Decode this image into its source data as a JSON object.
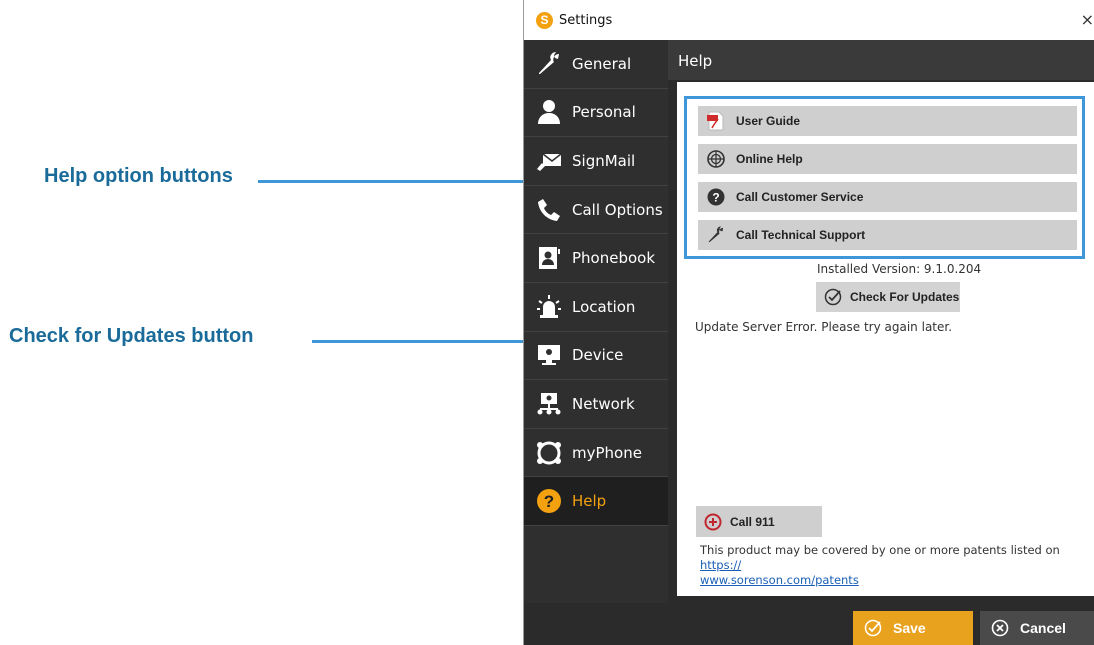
{
  "callouts": {
    "help_options": "Help option buttons",
    "check_updates": "Check for Updates button"
  },
  "window": {
    "title": "Settings",
    "logo_glyph": "S",
    "close_glyph": "×"
  },
  "sidebar": {
    "items": [
      {
        "label": "General",
        "icon": "wrench-icon"
      },
      {
        "label": "Personal",
        "icon": "person-icon"
      },
      {
        "label": "SignMail",
        "icon": "signmail-icon"
      },
      {
        "label": "Call Options",
        "icon": "phone-handset-icon"
      },
      {
        "label": "Phonebook",
        "icon": "phonebook-icon"
      },
      {
        "label": "Location",
        "icon": "siren-icon"
      },
      {
        "label": "Device",
        "icon": "monitor-icon"
      },
      {
        "label": "Network",
        "icon": "network-icon"
      },
      {
        "label": "myPhone",
        "icon": "myphone-icon"
      },
      {
        "label": "Help",
        "icon": "question-icon",
        "active": true
      }
    ]
  },
  "main": {
    "title": "Help",
    "help_buttons": [
      {
        "label": "User Guide",
        "icon": "pdf-icon"
      },
      {
        "label": "Online Help",
        "icon": "globe-icon"
      },
      {
        "label": "Call Customer Service",
        "icon": "question-circle-icon"
      },
      {
        "label": "Call Technical Support",
        "icon": "wrench-icon"
      }
    ],
    "installed_version": "Installed Version:  9.1.0.204",
    "check_updates_label": "Check For Updates",
    "error_message": "Update Server Error.  Please try again later.",
    "call911_label": "Call 911",
    "patent_text": "This product may be covered by one or more patents listed on ",
    "patent_link": "https://\nwww.sorenson.com/patents"
  },
  "footer": {
    "save_label": "Save",
    "cancel_label": "Cancel"
  },
  "colors": {
    "accent": "#f3a10f",
    "callout": "#3d97d8",
    "callout_text": "#1a6b9a"
  }
}
